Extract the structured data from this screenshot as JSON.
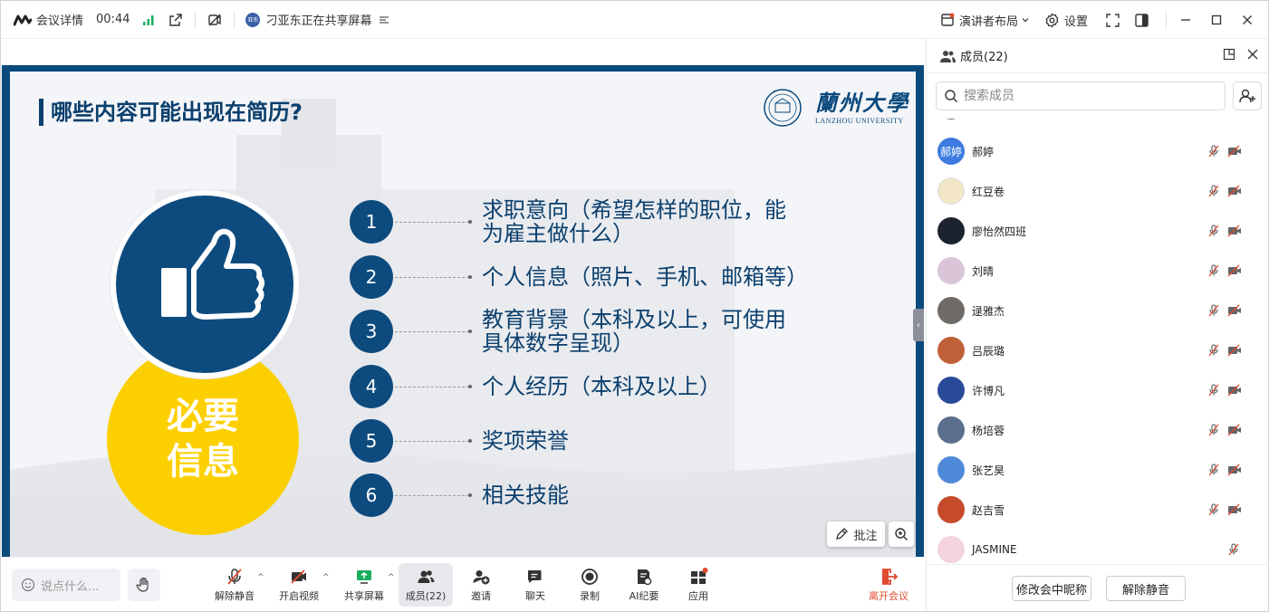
{
  "topbar": {
    "meeting_details": "会议详情",
    "timer": "00:44",
    "sharing_status": "刁亚东正在共享屏幕",
    "layout_label": "演讲者布局",
    "settings_label": "设置"
  },
  "slide": {
    "title": "哪些内容可能出现在简历?",
    "university_cn": "蘭州大學",
    "university_en": "LANZHOU UNIVERSITY",
    "yellow_line1": "必要",
    "yellow_line2": "信息",
    "items": [
      {
        "num": "1",
        "line1": "求职意向（希望怎样的职位，能",
        "line2": "为雇主做什么）"
      },
      {
        "num": "2",
        "line1": "个人信息（照片、手机、邮箱等）",
        "line2": ""
      },
      {
        "num": "3",
        "line1": "教育背景（本科及以上，可使用",
        "line2": "具体数字呈现）"
      },
      {
        "num": "4",
        "line1": "个人经历（本科及以上）",
        "line2": ""
      },
      {
        "num": "5",
        "line1": "奖项荣誉",
        "line2": ""
      },
      {
        "num": "6",
        "line1": "相关技能",
        "line2": ""
      }
    ],
    "colors": {
      "primary": "#0d4b7e",
      "yellow": "#fcd000"
    }
  },
  "share_controls": {
    "annotate_label": "批注"
  },
  "bottombar": {
    "chat_placeholder": "说点什么...",
    "tools": {
      "unmute": "解除静音",
      "start_video": "开启视频",
      "share_screen": "共享屏幕",
      "members": "成员(22)",
      "invite": "邀请",
      "chat": "聊天",
      "record": "录制",
      "ai_minutes": "AI纪要",
      "apps": "应用",
      "leave": "离开会议"
    }
  },
  "panel": {
    "title": "成员(22)",
    "search_placeholder": "搜索成员",
    "members": [
      {
        "name": "郝婷",
        "avatar_text": "郝婷",
        "avatar_color": "#3d7be0"
      },
      {
        "name": "红豆卷",
        "avatar_text": "",
        "avatar_color": "#f3e6c9"
      },
      {
        "name": "廖怡然四班",
        "avatar_text": "",
        "avatar_color": "#1d2230"
      },
      {
        "name": "刘晴",
        "avatar_text": "",
        "avatar_color": "#d9c4d8"
      },
      {
        "name": "逯雅杰",
        "avatar_text": "",
        "avatar_color": "#6f6a66"
      },
      {
        "name": "吕辰璐",
        "avatar_text": "",
        "avatar_color": "#c0603a"
      },
      {
        "name": "许博凡",
        "avatar_text": "",
        "avatar_color": "#2a4b9a"
      },
      {
        "name": "杨培蓉",
        "avatar_text": "",
        "avatar_color": "#5b6f8c"
      },
      {
        "name": "张艺昊",
        "avatar_text": "",
        "avatar_color": "#4f8ad8"
      },
      {
        "name": "赵吉雪",
        "avatar_text": "",
        "avatar_color": "#c64b2b"
      },
      {
        "name": "JASMINE",
        "avatar_text": "",
        "avatar_color": "#f2d3de"
      }
    ],
    "rename_button": "修改会中昵称",
    "unmute_button": "解除静音"
  }
}
